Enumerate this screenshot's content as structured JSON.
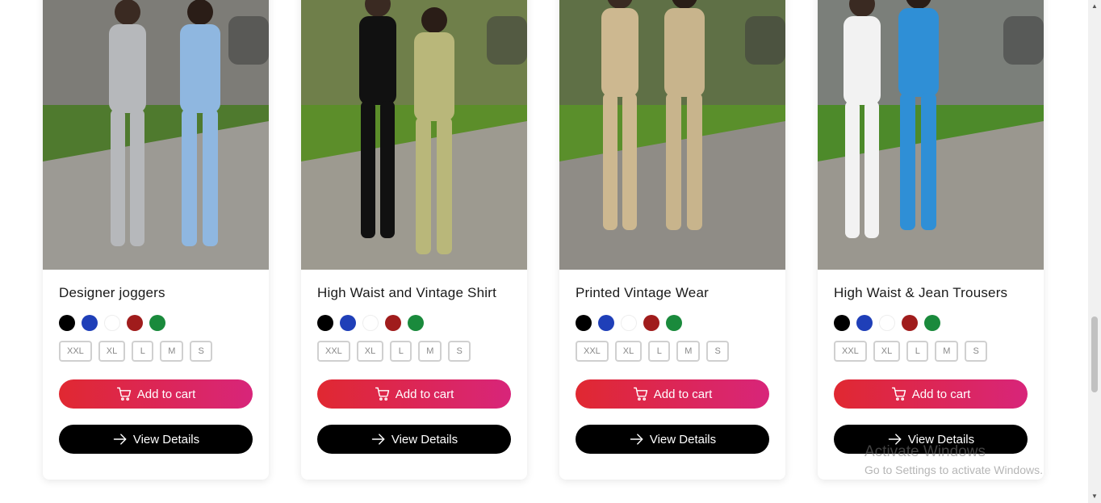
{
  "products": [
    {
      "title": "Designer joggers",
      "colors": [
        "#000000",
        "#1f3fb8",
        "#ffffff",
        "#a01c1c",
        "#1a8a3c"
      ],
      "sizes": [
        "XXL",
        "XL",
        "L",
        "M",
        "S"
      ],
      "add_label": "Add to cart",
      "view_label": "View Details",
      "photo": {
        "bg": "#7d7c77",
        "ground": "#9c9a94",
        "grass": "#4f7a2e",
        "figure_a": "#b6b8bb",
        "figure_b": "#8fb7e0"
      }
    },
    {
      "title": "High Waist and Vintage Shirt",
      "colors": [
        "#000000",
        "#1f3fb8",
        "#ffffff",
        "#a01c1c",
        "#1a8a3c"
      ],
      "sizes": [
        "XXL",
        "XL",
        "L",
        "M",
        "S"
      ],
      "add_label": "Add to cart",
      "view_label": "View Details",
      "photo": {
        "bg": "#6f7f4a",
        "ground": "#9d9a90",
        "grass": "#5c8e2a",
        "figure_a": "#111111",
        "figure_b": "#b9b77a"
      }
    },
    {
      "title": "Printed Vintage Wear",
      "colors": [
        "#000000",
        "#1f3fb8",
        "#ffffff",
        "#a01c1c",
        "#1a8a3c"
      ],
      "sizes": [
        "XXL",
        "XL",
        "L",
        "M",
        "S"
      ],
      "add_label": "Add to cart",
      "view_label": "View Details",
      "photo": {
        "bg": "#5f7046",
        "ground": "#8f8c86",
        "grass": "#5a8f2b",
        "figure_a": "#cdb890",
        "figure_b": "#c8b48c"
      }
    },
    {
      "title": "High Waist & Jean Trousers",
      "colors": [
        "#000000",
        "#1f3fb8",
        "#ffffff",
        "#a01c1c",
        "#1a8a3c"
      ],
      "sizes": [
        "XXL",
        "XL",
        "L",
        "M",
        "S"
      ],
      "add_label": "Add to cart",
      "view_label": "View Details",
      "photo": {
        "bg": "#7b7f7a",
        "ground": "#9a978f",
        "grass": "#4d8a2a",
        "figure_a": "#f2f2f2",
        "figure_b": "#2f8fd6"
      }
    }
  ],
  "watermark": {
    "title": "Activate Windows",
    "subtitle": "Go to Settings to activate Windows."
  },
  "scrollbar": {
    "position_fraction": 0.8
  },
  "icons": {
    "cart": "cart-icon",
    "view": "arrow-right-icon"
  }
}
